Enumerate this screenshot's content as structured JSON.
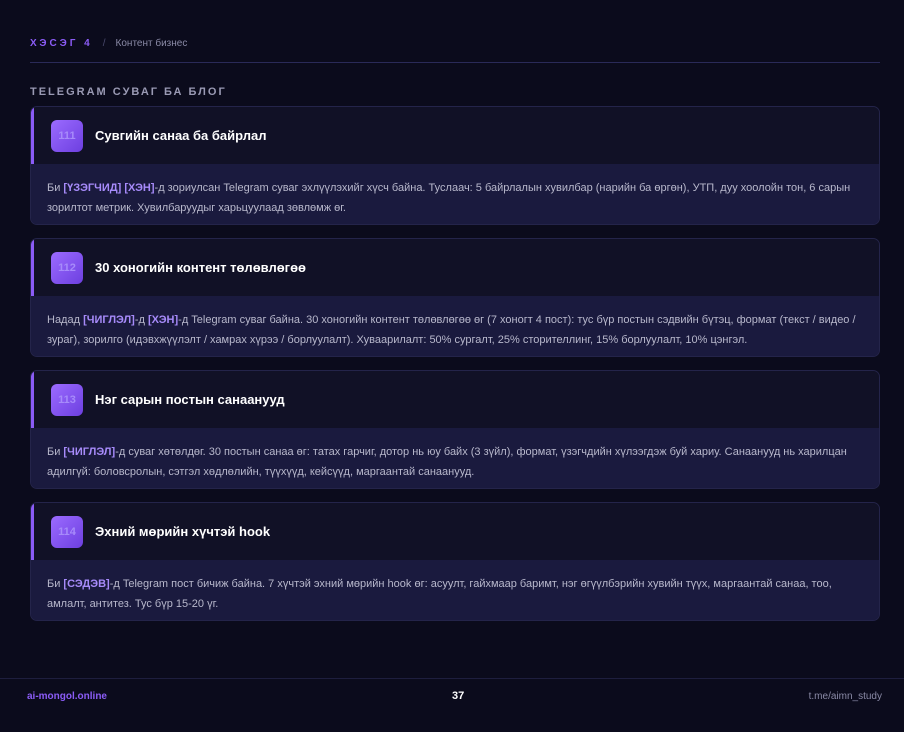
{
  "header": {
    "section_tag": "ХЭСЭГ 4",
    "separator": "/",
    "title": "Контент бизнес"
  },
  "group_heading": "TELEGRAM СУВАГ БА БЛОГ",
  "cards": [
    {
      "number": "111",
      "title": "Сувгийн санаа ба байрлал",
      "body": [
        {
          "t": "Би ",
          "hl": false
        },
        {
          "t": "[ҮЗЭГЧИД]",
          "hl": true
        },
        {
          "t": " ",
          "hl": false
        },
        {
          "t": "[ХЭН]",
          "hl": true
        },
        {
          "t": "-д зориулсан Telegram суваг эхлүүлэхийг хүсч байна. Туслаач: 5 байрлалын хувилбар (нарийн ба өргөн), УТП, дуу хоолойн тон, 6 сарын зорилтот метрик. Хувилбаруудыг харьцуулаад зөвлөмж өг.",
          "hl": false
        }
      ]
    },
    {
      "number": "112",
      "title": "30 хоногийн контент төлөвлөгөө",
      "body": [
        {
          "t": "Надад ",
          "hl": false
        },
        {
          "t": "[ЧИГЛЭЛ]",
          "hl": true
        },
        {
          "t": "-д ",
          "hl": false
        },
        {
          "t": "[ХЭН]",
          "hl": true
        },
        {
          "t": "-д Telegram суваг байна. 30 хоногийн контент төлөвлөгөө өг (7 хоногт 4 пост): тус бүр постын сэдвийн бүтэц, формат (текст / видео / зураг), зорилго (идэвхжүүлэлт / хамрах хүрээ / борлуулалт). Хуваарилалт: 50% сургалт, 25% сторителлинг, 15% борлуулалт, 10% цэнгэл.",
          "hl": false
        }
      ]
    },
    {
      "number": "113",
      "title": "Нэг сарын постын санаанууд",
      "body": [
        {
          "t": "Би ",
          "hl": false
        },
        {
          "t": "[ЧИГЛЭЛ]",
          "hl": true
        },
        {
          "t": "-д суваг хөтөлдөг. 30 постын санаа өг: татах гарчиг, дотор нь юу байх (3 зүйл), формат, үзэгчдийн хүлээгдэж буй хариу. Санаанууд нь харилцан адилгүй: боловсролын, сэтгэл хөдлөлийн, түүхүүд, кейсүүд, маргаантай санаанууд.",
          "hl": false
        }
      ]
    },
    {
      "number": "114",
      "title": "Эхний мөрийн хүчтэй hook",
      "body": [
        {
          "t": "Би ",
          "hl": false
        },
        {
          "t": "[СЭДЭВ]",
          "hl": true
        },
        {
          "t": "-д Telegram пост бичиж байна. 7 хүчтэй эхний мөрийн hook өг: асуулт, гайхмаар баримт, нэг өгүүлбэрийн хувийн түүх, маргаантай санаа, тоо, амлалт, антитез. Тус бүр 15-20 үг.",
          "hl": false
        }
      ]
    }
  ],
  "footer": {
    "site": "ai-mongol.online",
    "page_number": "37",
    "channel": "t.me/aimn_study"
  },
  "colors": {
    "background": "#0b0b1c",
    "accent": "#8b5cf6",
    "highlight": "#a78bfa"
  }
}
